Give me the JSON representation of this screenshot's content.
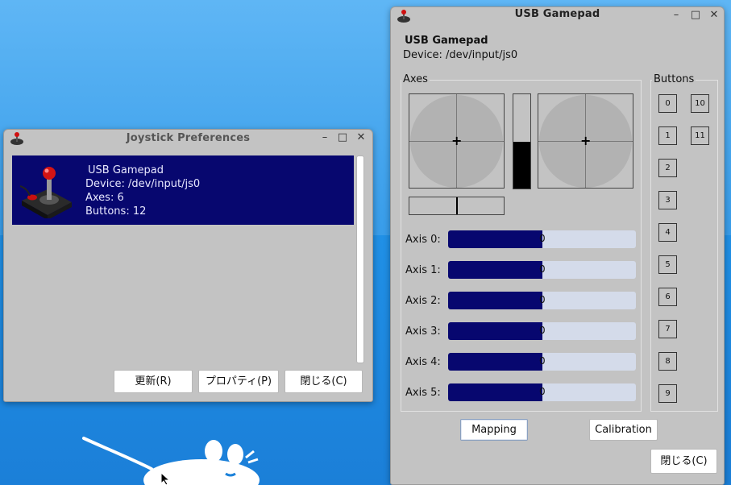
{
  "prefs": {
    "title": "Joystick Preferences",
    "device": {
      "name": "USB Gamepad",
      "device_line": "Device: /dev/input/js0",
      "axes_line": "Axes: 6",
      "buttons_line": "Buttons: 12"
    },
    "refresh_label": "更新(R)",
    "properties_label": "プロパティ(P)",
    "close_label": "閉じる(C)"
  },
  "pad": {
    "title": "USB Gamepad",
    "device_name": "USB Gamepad",
    "device_line": "Device: /dev/input/js0",
    "axes_label": "Axes",
    "buttons_label": "Buttons",
    "axis_rows": [
      {
        "label": "Axis 0:",
        "value": "0",
        "fraction": 0.5
      },
      {
        "label": "Axis 1:",
        "value": "0",
        "fraction": 0.5
      },
      {
        "label": "Axis 2:",
        "value": "0",
        "fraction": 0.5
      },
      {
        "label": "Axis 3:",
        "value": "0",
        "fraction": 0.5
      },
      {
        "label": "Axis 4:",
        "value": "0",
        "fraction": 0.5
      },
      {
        "label": "Axis 5:",
        "value": "0",
        "fraction": 0.5
      }
    ],
    "throttle_fraction": 0.5,
    "hbar_fraction": 0.5,
    "buttons": [
      "0",
      "1",
      "2",
      "3",
      "4",
      "5",
      "6",
      "7",
      "8",
      "9",
      "10",
      "11"
    ],
    "mapping_label": "Mapping",
    "calibration_label": "Calibration",
    "close_label": "閉じる(C)"
  },
  "window_controls": {
    "minimize": "–",
    "maximize": "□",
    "close": "✕"
  },
  "icons": [
    "joystick-icon",
    "app-icon",
    "minimize-icon",
    "maximize-icon",
    "close-icon",
    "mouse-logo-icon"
  ]
}
